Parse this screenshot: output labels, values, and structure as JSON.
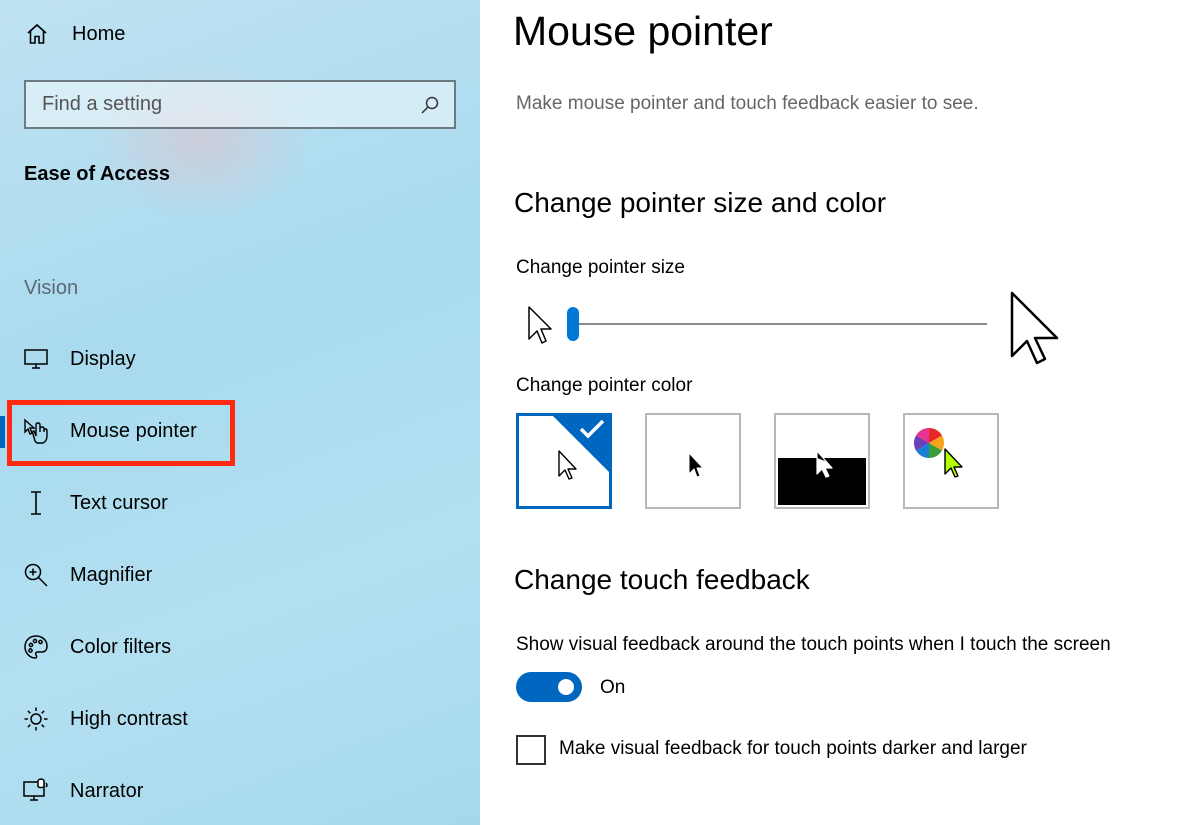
{
  "sidebar": {
    "home_label": "Home",
    "search_placeholder": "Find a setting",
    "section_title": "Ease of Access",
    "group_label": "Vision",
    "items": [
      {
        "label": "Display",
        "icon": "monitor-icon"
      },
      {
        "label": "Mouse pointer",
        "icon": "pointer-hand-icon",
        "active": true
      },
      {
        "label": "Text cursor",
        "icon": "text-cursor-icon"
      },
      {
        "label": "Magnifier",
        "icon": "magnifier-icon"
      },
      {
        "label": "Color filters",
        "icon": "palette-icon"
      },
      {
        "label": "High contrast",
        "icon": "sun-icon"
      },
      {
        "label": "Narrator",
        "icon": "narrator-icon"
      }
    ]
  },
  "main": {
    "title": "Mouse pointer",
    "description": "Make mouse pointer and touch feedback easier to see.",
    "size_color_heading": "Change pointer size and color",
    "size_label": "Change pointer size",
    "size_value_fraction": 0.0,
    "color_label": "Change pointer color",
    "color_options": [
      {
        "id": "white",
        "selected": true
      },
      {
        "id": "black",
        "selected": false
      },
      {
        "id": "inverted",
        "selected": false
      },
      {
        "id": "custom",
        "selected": false,
        "custom_color": "#b4ff00"
      }
    ],
    "touch_heading": "Change touch feedback",
    "touch_label": "Show visual feedback around the touch points when I touch the screen",
    "toggle_state": "On",
    "checkbox_label": "Make visual feedback for touch points darker and larger",
    "checkbox_checked": false
  },
  "colors": {
    "accent": "#0067c0",
    "highlight_box": "#ff2a10"
  }
}
